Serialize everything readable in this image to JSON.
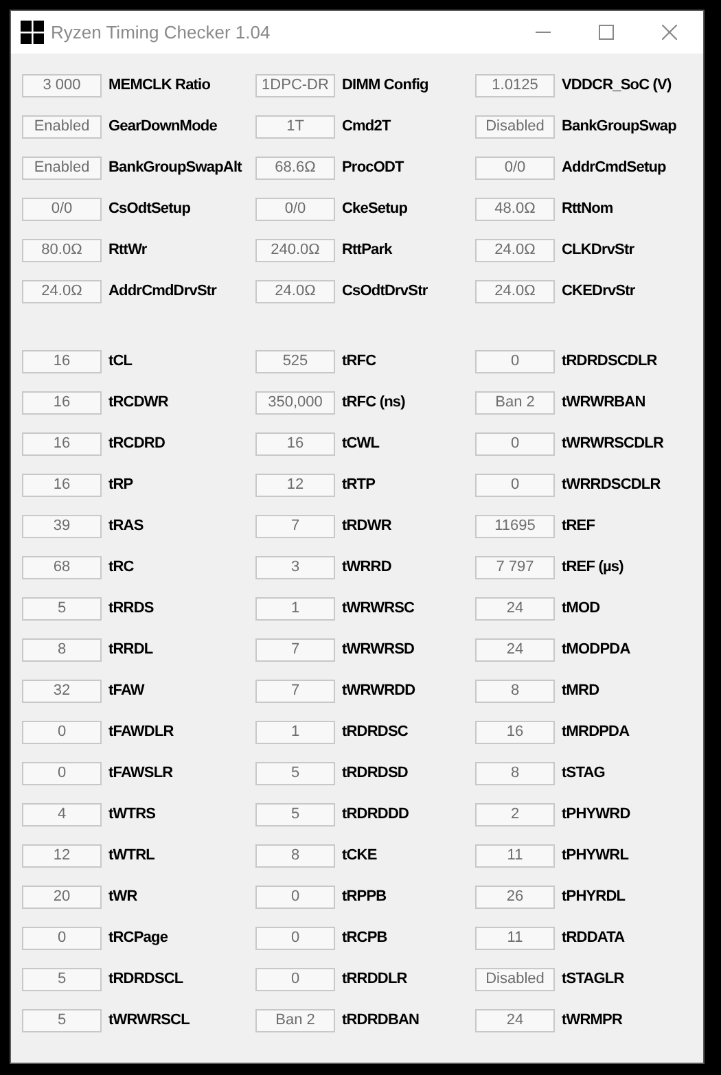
{
  "window": {
    "title": "Ryzen Timing Checker 1.04"
  },
  "sections": [
    {
      "rows": [
        [
          {
            "value": "3 000",
            "label": "MEMCLK Ratio"
          },
          {
            "value": "1DPC-DR",
            "label": "DIMM Config"
          },
          {
            "value": "1.0125",
            "label": "VDDCR_SoC (V)"
          }
        ],
        [
          {
            "value": "Enabled",
            "label": "GearDownMode"
          },
          {
            "value": "1T",
            "label": "Cmd2T"
          },
          {
            "value": "Disabled",
            "label": "BankGroupSwap"
          }
        ],
        [
          {
            "value": "Enabled",
            "label": "BankGroupSwapAlt"
          },
          {
            "value": "68.6Ω",
            "label": "ProcODT"
          },
          {
            "value": "0/0",
            "label": "AddrCmdSetup"
          }
        ],
        [
          {
            "value": "0/0",
            "label": "CsOdtSetup"
          },
          {
            "value": "0/0",
            "label": "CkeSetup"
          },
          {
            "value": "48.0Ω",
            "label": "RttNom"
          }
        ],
        [
          {
            "value": "80.0Ω",
            "label": "RttWr"
          },
          {
            "value": "240.0Ω",
            "label": "RttPark"
          },
          {
            "value": "24.0Ω",
            "label": "CLKDrvStr"
          }
        ],
        [
          {
            "value": "24.0Ω",
            "label": "AddrCmdDrvStr"
          },
          {
            "value": "24.0Ω",
            "label": "CsOdtDrvStr"
          },
          {
            "value": "24.0Ω",
            "label": "CKEDrvStr"
          }
        ]
      ]
    },
    {
      "rows": [
        [
          {
            "value": "16",
            "label": "tCL"
          },
          {
            "value": "525",
            "label": "tRFC"
          },
          {
            "value": "0",
            "label": "tRDRDSCDLR"
          }
        ],
        [
          {
            "value": "16",
            "label": "tRCDWR"
          },
          {
            "value": "350,000",
            "label": "tRFC (ns)"
          },
          {
            "value": "Ban 2",
            "label": "tWRWRBAN"
          }
        ],
        [
          {
            "value": "16",
            "label": "tRCDRD"
          },
          {
            "value": "16",
            "label": "tCWL"
          },
          {
            "value": "0",
            "label": "tWRWRSCDLR"
          }
        ],
        [
          {
            "value": "16",
            "label": "tRP"
          },
          {
            "value": "12",
            "label": "tRTP"
          },
          {
            "value": "0",
            "label": "tWRRDSCDLR"
          }
        ],
        [
          {
            "value": "39",
            "label": "tRAS"
          },
          {
            "value": "7",
            "label": "tRDWR"
          },
          {
            "value": "11695",
            "label": "tREF"
          }
        ],
        [
          {
            "value": "68",
            "label": "tRC"
          },
          {
            "value": "3",
            "label": "tWRRD"
          },
          {
            "value": "7 797",
            "label": "tREF (µs)"
          }
        ],
        [
          {
            "value": "5",
            "label": "tRRDS"
          },
          {
            "value": "1",
            "label": "tWRWRSC"
          },
          {
            "value": "24",
            "label": "tMOD"
          }
        ],
        [
          {
            "value": "8",
            "label": "tRRDL"
          },
          {
            "value": "7",
            "label": "tWRWRSD"
          },
          {
            "value": "24",
            "label": "tMODPDA"
          }
        ],
        [
          {
            "value": "32",
            "label": "tFAW"
          },
          {
            "value": "7",
            "label": "tWRWRDD"
          },
          {
            "value": "8",
            "label": "tMRD"
          }
        ],
        [
          {
            "value": "0",
            "label": "tFAWDLR"
          },
          {
            "value": "1",
            "label": "tRDRDSC"
          },
          {
            "value": "16",
            "label": "tMRDPDA"
          }
        ],
        [
          {
            "value": "0",
            "label": "tFAWSLR"
          },
          {
            "value": "5",
            "label": "tRDRDSD"
          },
          {
            "value": "8",
            "label": "tSTAG"
          }
        ],
        [
          {
            "value": "4",
            "label": "tWTRS"
          },
          {
            "value": "5",
            "label": "tRDRDDD"
          },
          {
            "value": "2",
            "label": "tPHYWRD"
          }
        ],
        [
          {
            "value": "12",
            "label": "tWTRL"
          },
          {
            "value": "8",
            "label": "tCKE"
          },
          {
            "value": "11",
            "label": "tPHYWRL"
          }
        ],
        [
          {
            "value": "20",
            "label": "tWR"
          },
          {
            "value": "0",
            "label": "tRPPB"
          },
          {
            "value": "26",
            "label": "tPHYRDL"
          }
        ],
        [
          {
            "value": "0",
            "label": "tRCPage"
          },
          {
            "value": "0",
            "label": "tRCPB"
          },
          {
            "value": "11",
            "label": "tRDDATA"
          }
        ],
        [
          {
            "value": "5",
            "label": "tRDRDSCL"
          },
          {
            "value": "0",
            "label": "tRRDDLR"
          },
          {
            "value": "Disabled",
            "label": "tSTAGLR"
          }
        ],
        [
          {
            "value": "5",
            "label": "tWRWRSCL"
          },
          {
            "value": "Ban 2",
            "label": "tRDRDBAN"
          },
          {
            "value": "24",
            "label": "tWRMPR"
          }
        ]
      ]
    }
  ]
}
